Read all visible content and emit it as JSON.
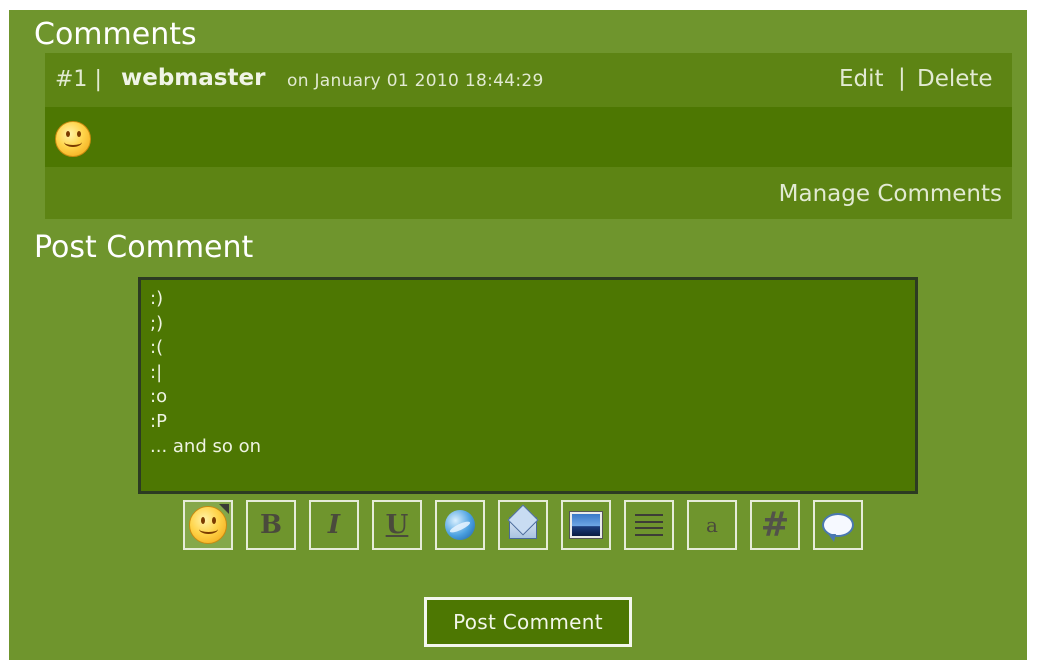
{
  "comments": {
    "heading": "Comments",
    "items": [
      {
        "number": "#1",
        "separator": "|",
        "author": "webmaster",
        "date_text": "on January 01 2010 18:44:29",
        "edit_label": "Edit",
        "actions_separator": "|",
        "delete_label": "Delete",
        "body_icon": "smiley-icon"
      }
    ],
    "manage_label": "Manage Comments"
  },
  "post": {
    "heading": "Post Comment",
    "textarea_value": ":)\n;)\n:(\n:|\n:o\n:P\n... and so on",
    "toolbar": [
      {
        "name": "smiley-icon",
        "glyph": ""
      },
      {
        "name": "bold-icon",
        "glyph": "B"
      },
      {
        "name": "italic-icon",
        "glyph": "I"
      },
      {
        "name": "underline-icon",
        "glyph": "U"
      },
      {
        "name": "link-globe-icon",
        "glyph": ""
      },
      {
        "name": "email-icon",
        "glyph": ""
      },
      {
        "name": "image-icon",
        "glyph": ""
      },
      {
        "name": "align-center-icon",
        "glyph": ""
      },
      {
        "name": "font-size-icon",
        "glyph": "a"
      },
      {
        "name": "code-hash-icon",
        "glyph": "#"
      },
      {
        "name": "quote-bubble-icon",
        "glyph": ""
      }
    ],
    "submit_label": "Post Comment"
  },
  "colors": {
    "page_bg": "#6f952d",
    "comment_head_bg": "#5d8414",
    "comment_body_bg": "#4d7702",
    "text_light": "#e2ead2"
  }
}
